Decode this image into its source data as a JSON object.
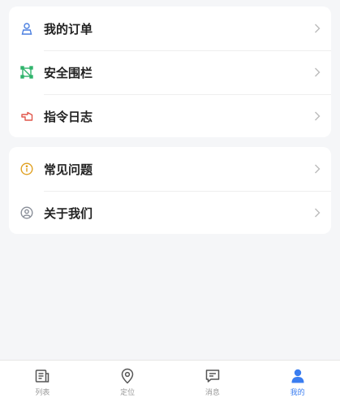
{
  "menu_group_1": [
    {
      "label": "我的订单",
      "icon": "user-badge-icon",
      "color": "#4a7fe0"
    },
    {
      "label": "安全围栏",
      "icon": "fence-icon",
      "color": "#2fb36b"
    },
    {
      "label": "指令日志",
      "icon": "pointing-hand-icon",
      "color": "#e0564a"
    }
  ],
  "menu_group_2": [
    {
      "label": "常见问题",
      "icon": "info-icon",
      "color": "#e0a020"
    },
    {
      "label": "关于我们",
      "icon": "user-circle-icon",
      "color": "#8a8f99"
    }
  ],
  "tabbar": {
    "tabs": [
      {
        "label": "列表",
        "icon": "list-icon"
      },
      {
        "label": "定位",
        "icon": "location-pin-icon"
      },
      {
        "label": "消息",
        "icon": "message-icon"
      },
      {
        "label": "我的",
        "icon": "person-icon"
      }
    ],
    "active_index": 3,
    "active_color": "#3a7df0",
    "inactive_color": "#999999"
  }
}
